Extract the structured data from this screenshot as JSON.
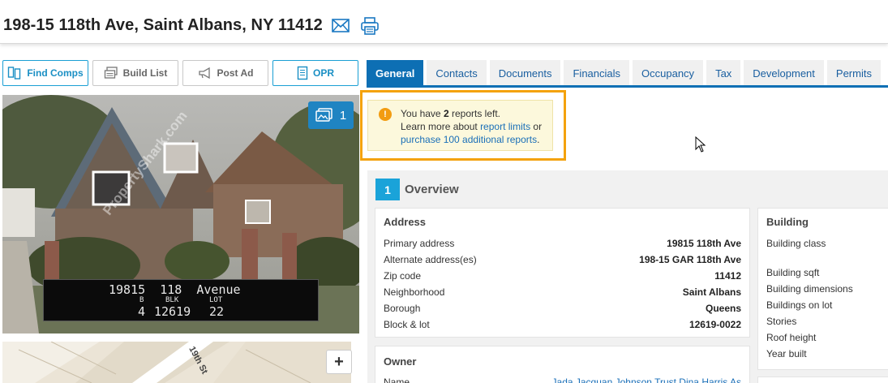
{
  "header": {
    "title": "198-15 118th Ave, Saint Albans, NY 11412",
    "email_icon": "envelope-icon",
    "print_icon": "printer-icon"
  },
  "actions": {
    "find_comps": "Find Comps",
    "build_list": "Build List",
    "post_ad": "Post Ad",
    "opr": "OPR"
  },
  "tabs": [
    "General",
    "Contacts",
    "Documents",
    "Financials",
    "Occupancy",
    "Tax",
    "Development",
    "Permits"
  ],
  "active_tab": "General",
  "photo": {
    "count": "1",
    "watermark": "PropertyShark.com",
    "caption_line1": "19815  118  Avenue",
    "caption_b": "B",
    "caption_blk": "BLK",
    "caption_lot": "LOT",
    "caption_num1": "4",
    "caption_num2": "12619",
    "caption_num3": "22"
  },
  "map": {
    "street_label": "19th St",
    "zoom_in": "+"
  },
  "notice": {
    "line1_pre": "You have ",
    "count": "2",
    "line1_post": " reports left.",
    "line2_pre": "Learn more about ",
    "link1": "report limits",
    "line2_post": " or",
    "link2": "purchase 100 additional reports",
    "line3_post": "."
  },
  "overview": {
    "number": "1",
    "title": "Overview"
  },
  "address": {
    "heading": "Address",
    "rows": [
      {
        "label": "Primary address",
        "value": "19815 118th Ave"
      },
      {
        "label": "Alternate address(es)",
        "value": "198-15 GAR 118th Ave"
      },
      {
        "label": "Zip code",
        "value": "11412"
      },
      {
        "label": "Neighborhood",
        "value": "Saint Albans"
      },
      {
        "label": "Borough",
        "value": "Queens"
      },
      {
        "label": "Block & lot",
        "value": "12619-0022"
      }
    ]
  },
  "owner": {
    "heading": "Owner",
    "name_label": "Name",
    "name_value": "Jada Jacquan Johnson Trust Dina Harris As"
  },
  "building": {
    "heading": "Building",
    "rows": [
      "Building class",
      "Building sqft",
      "Building dimensions",
      "Buildings on lot",
      "Stories",
      "Roof height",
      "Year built"
    ]
  },
  "colors": {
    "accent": "#0d6fb4",
    "notice_border": "#f4a20c",
    "notice_bg": "#fcf8dc",
    "badge": "#1aa3d9"
  }
}
